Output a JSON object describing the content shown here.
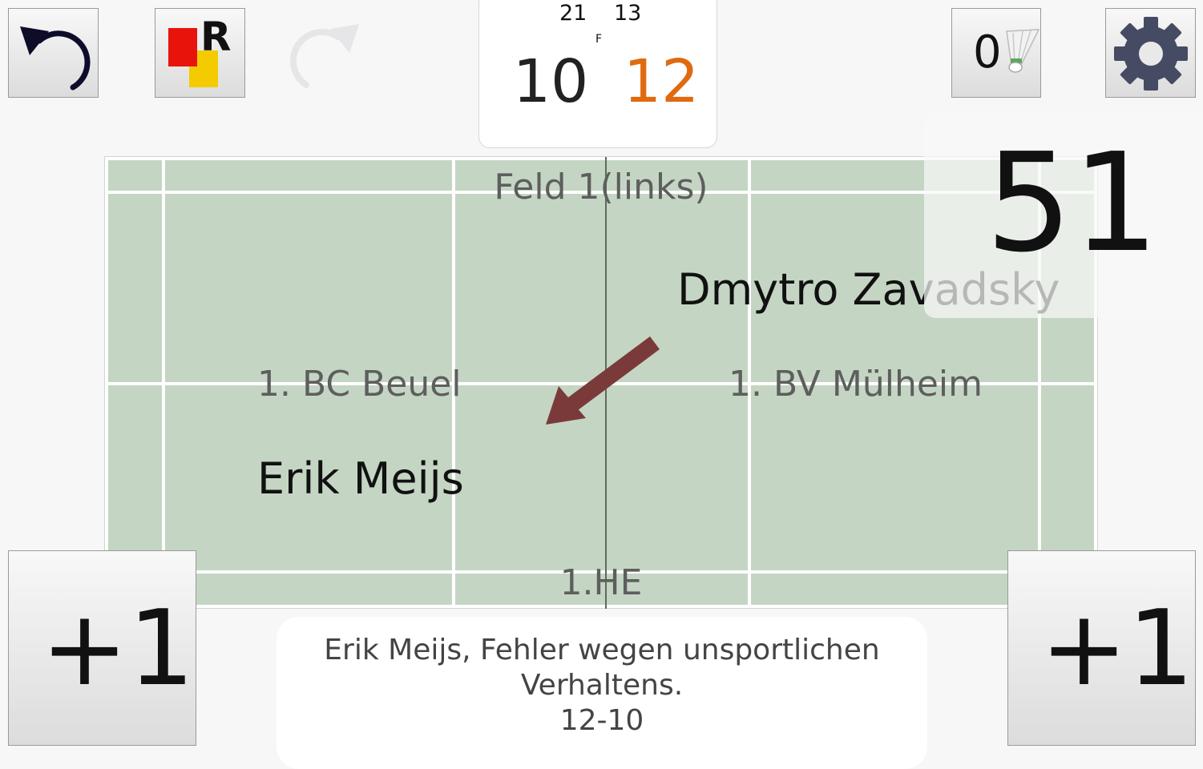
{
  "toolbar": {
    "undo_icon": "undo-icon",
    "card_label": "R",
    "card_icon": "red-yellow-card-icon",
    "redo_icon": "redo-icon",
    "shuttle_count": "0",
    "shuttle_icon": "shuttlecock-icon",
    "settings_icon": "gear-icon"
  },
  "scoreboard": {
    "game1_left": "21",
    "game1_right": "13",
    "game_marker": "F",
    "current_left": "10",
    "current_right": "12",
    "colors": {
      "left": "#222222",
      "right": "#e06a10"
    }
  },
  "court": {
    "label": "Feld 1(links)",
    "discipline": "1.HE",
    "team_left": "1. BC Beuel",
    "team_right": "1. BV Mülheim",
    "player_left": "Erik Meijs",
    "player_right": "Dmytro Zavadsky",
    "arrow_color": "#7b3a3a",
    "court_color": "#c4d5c4"
  },
  "timer": {
    "value": "51"
  },
  "buttons": {
    "left_plus": "+1",
    "right_plus": "+1"
  },
  "message": {
    "line1": "Erik Meijs, Fehler wegen unsportlichen",
    "line2": "Verhaltens.",
    "line3": "12-10"
  }
}
